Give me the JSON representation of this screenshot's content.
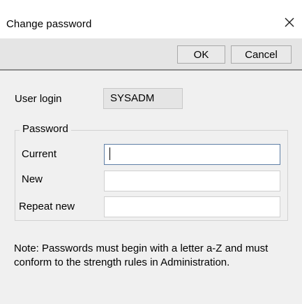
{
  "dialog": {
    "title": "Change password",
    "close_icon": "close-x-icon"
  },
  "toolbar": {
    "ok_label": "OK",
    "cancel_label": "Cancel"
  },
  "user": {
    "login_label": "User login",
    "login_value": "SYSADM"
  },
  "password_group": {
    "legend": "Password",
    "current_label": "Current",
    "current_value": "",
    "new_label": "New",
    "new_value": "",
    "repeat_label": "Repeat new",
    "repeat_value": ""
  },
  "note": "Note: Passwords must begin with a letter a-Z and must conform to the strength rules in Administration."
}
